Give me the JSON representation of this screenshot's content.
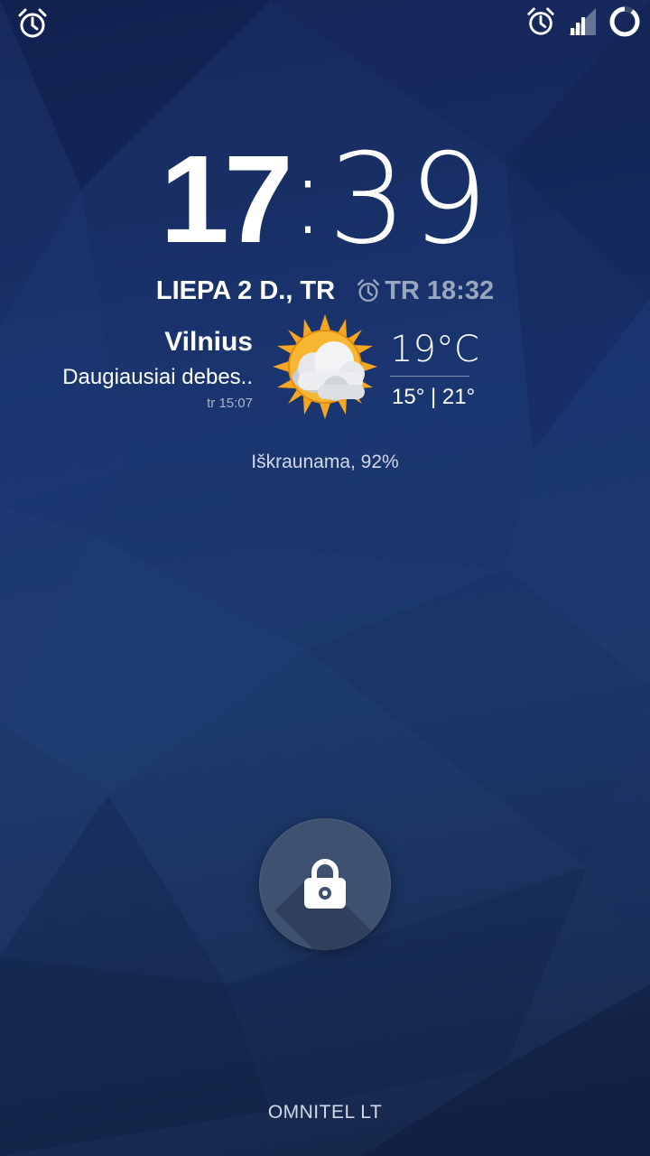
{
  "status_bar": {
    "left_icon": "alarm-icon",
    "right_icons": [
      "alarm-icon",
      "signal-icon",
      "battery-ring-icon"
    ]
  },
  "clock": {
    "hours": "17",
    "separator": ":",
    "minutes": "39"
  },
  "date": {
    "text": "LIEPA 2 D., TR",
    "next_alarm": "TR 18:32"
  },
  "weather": {
    "city": "Vilnius",
    "description": "Daugiausiai debes..",
    "updated": "tr 15:07",
    "icon": "partly-cloudy-icon",
    "temperature": "19°C",
    "range": "15° | 21°"
  },
  "charging": "Iškraunama, 92%",
  "lock": {
    "icon": "lock-icon"
  },
  "carrier": "OMNITEL LT",
  "colors": {
    "background": "#1a3570",
    "accent_muted": "#9aa6bd",
    "sun": "#f5a623"
  }
}
